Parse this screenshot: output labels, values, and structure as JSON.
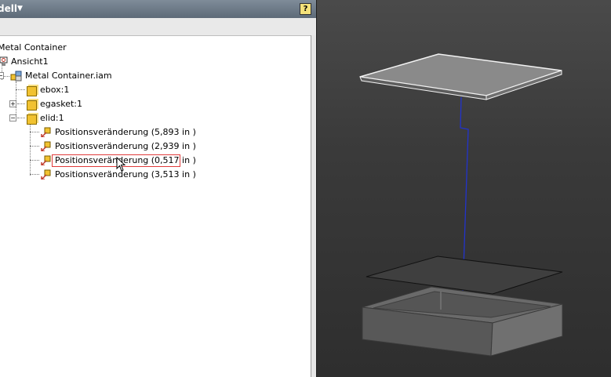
{
  "panel": {
    "title": "dell",
    "help_label": "?"
  },
  "tree": {
    "root_label": "Metal Container",
    "view_label": "Ansicht1",
    "assembly_label": "Metal Container.iam",
    "ebox_label": "ebox:1",
    "egasket_label": "egasket:1",
    "elid_label": "elid:1",
    "position_changes": [
      "Positionsveränderung (5,893 in )",
      "Positionsveränderung (2,939 in )",
      "Positionsveränderung (0,517 in )",
      "Positionsveränderung (3,513 in )"
    ]
  },
  "icons": {
    "expand_plus": "+",
    "expand_minus": "−",
    "collapse_minus": "−"
  }
}
